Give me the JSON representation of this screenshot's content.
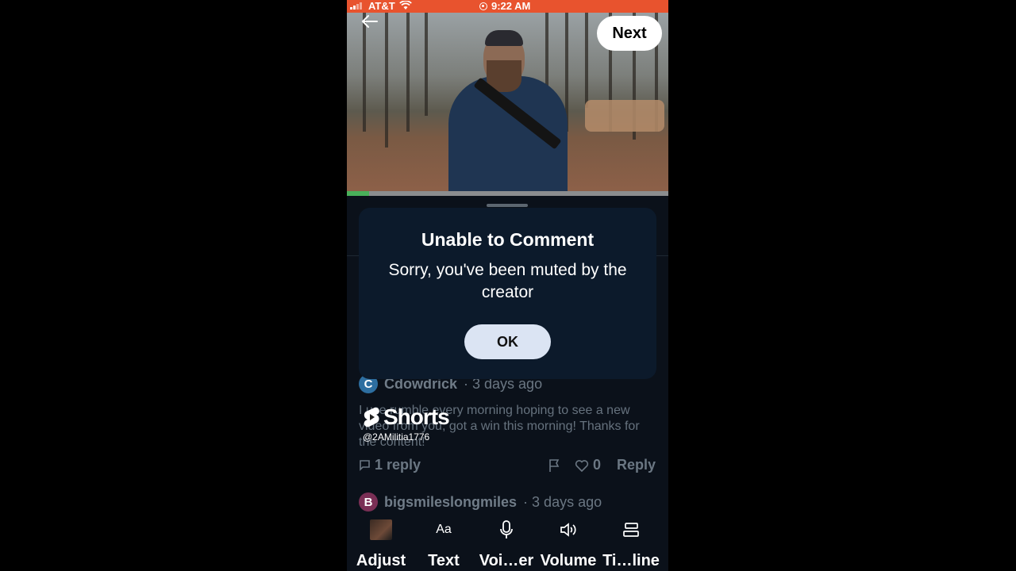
{
  "status_bar": {
    "carrier": "AT&T",
    "time": "9:22 AM",
    "bar_color": "#e8532e"
  },
  "video": {
    "next_label": "Next",
    "progress_percent": 7,
    "progress_color": "#49b05a"
  },
  "dialog": {
    "title": "Unable to Comment",
    "message": "Sorry, you've been muted by the creator",
    "ok_label": "OK"
  },
  "comments": [
    {
      "avatar_letter": "C",
      "avatar_color": "#2d6ea0",
      "user": "Cdowdrick",
      "time": "· 3 days ago",
      "text": "I use rumble every morning hoping to see a new video from you, got a win this morning! Thanks for the content!",
      "replies": "1 reply",
      "likes": "0",
      "reply_label": "Reply"
    },
    {
      "avatar_letter": "B",
      "avatar_color": "#7a2f55",
      "user": "bigsmileslongmiles",
      "time": "· 3 days ago"
    }
  ],
  "watermark": {
    "logo_text": "Shorts",
    "handle": "@2AMilitia1776"
  },
  "toolbar": {
    "items": [
      {
        "label": "Adjust",
        "icon": "thumbnail-icon"
      },
      {
        "label": "Text",
        "icon": "text-aa-icon"
      },
      {
        "label": "Voi…er",
        "icon": "microphone-icon"
      },
      {
        "label": "Volume",
        "icon": "speaker-icon"
      },
      {
        "label": "Ti…line",
        "icon": "timeline-icon"
      }
    ],
    "text_icon_glyph": "Aa"
  }
}
